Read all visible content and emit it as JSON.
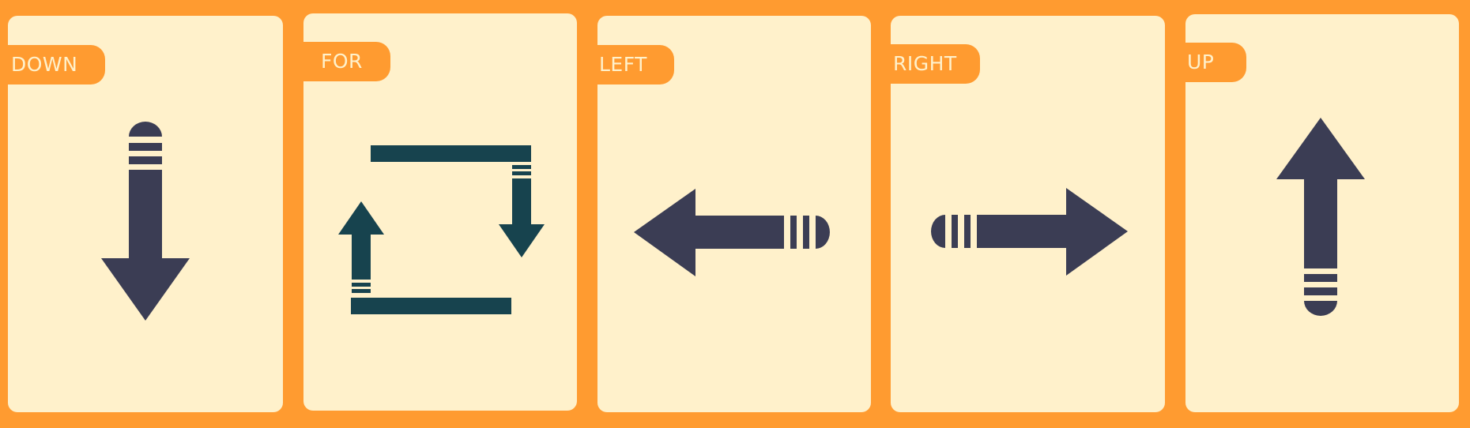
{
  "cards": [
    {
      "label": "DOWN",
      "icon": "arrow-down-icon"
    },
    {
      "label": "FOR",
      "icon": "loop-arrows-icon"
    },
    {
      "label": "LEFT",
      "icon": "arrow-left-icon"
    },
    {
      "label": "RIGHT",
      "icon": "arrow-right-icon"
    },
    {
      "label": "UP",
      "icon": "arrow-up-icon"
    }
  ],
  "colors": {
    "frame": "#FF9B30",
    "card": "#FFF1CB",
    "arrow_navy": "#3B3D54",
    "loop_teal": "#17434E",
    "label_text": "#FFF1CB"
  }
}
